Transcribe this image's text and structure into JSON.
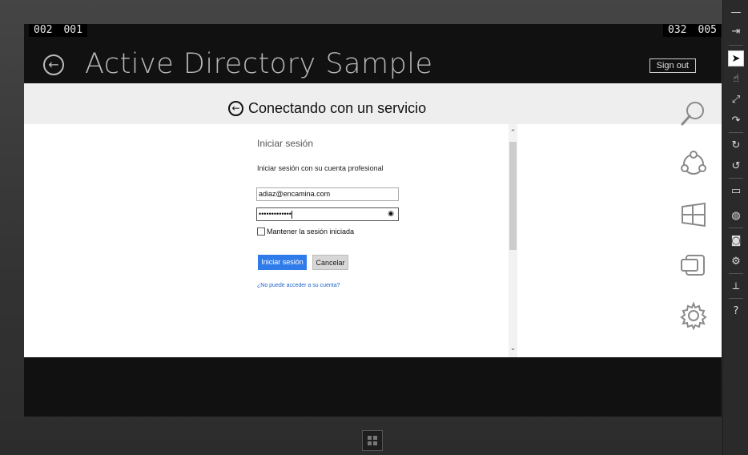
{
  "counters": {
    "left_a": "002",
    "left_b": "001",
    "right_a": "032",
    "right_b": "005"
  },
  "app": {
    "title": "Active Directory Sample",
    "sign_out": "Sign out"
  },
  "auth": {
    "title": "Conectando con un servicio"
  },
  "form": {
    "heading": "Iniciar sesión",
    "subtitle": "Iniciar sesión con su cuenta profesional",
    "email_value": "adiaz@encamina.com",
    "password_mask": "•••••••••••••",
    "keep_signed_in": "Mantener la sesión iniciada",
    "sign_in": "Iniciar sesión",
    "cancel": "Cancelar",
    "help_link": "¿No puede acceder a su cuenta?"
  }
}
